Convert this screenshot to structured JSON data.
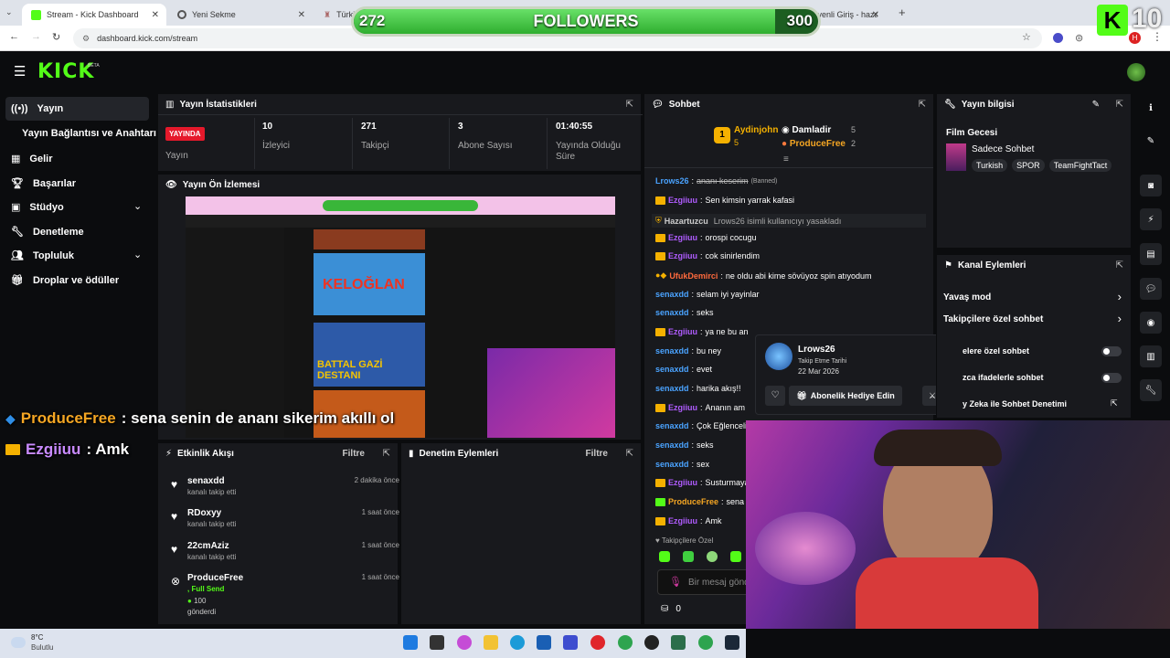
{
  "browser": {
    "tabs": [
      {
        "title": "Stream - Kick Dashboard",
        "active": true
      },
      {
        "title": "Yeni Sekme",
        "active": false
      },
      {
        "title": "Türki",
        "active": false
      },
      {
        "title": "e-posta Güvenli Giriş - hazartu",
        "active": false
      }
    ],
    "url": "dashboard.kick.com/stream"
  },
  "followers_goal": {
    "current": "272",
    "label": "FOLLOWERS",
    "target": "300",
    "progress": 0.907
  },
  "corner_count": "10",
  "sidebar": {
    "items": [
      {
        "label": "Yayın",
        "icon": "broadcast-icon",
        "active": true
      },
      {
        "label": "Yayın Bağlantısı ve Anahtarı",
        "icon": "",
        "active": false
      },
      {
        "label": "Gelir",
        "icon": "revenue-icon",
        "active": false
      },
      {
        "label": "Başarılar",
        "icon": "trophy-icon",
        "active": false
      },
      {
        "label": "Stüdyo",
        "icon": "studio-icon",
        "active": false
      },
      {
        "label": "Denetleme",
        "icon": "wrench-icon",
        "active": false
      },
      {
        "label": "Topluluk",
        "icon": "community-icon",
        "active": false
      },
      {
        "label": "Droplar ve ödüller",
        "icon": "gift-icon",
        "active": false
      }
    ]
  },
  "stats": {
    "title": "Yayın İstatistikleri",
    "live_badge": "YAYINDA",
    "live_label": "Yayın",
    "items": [
      {
        "value": "10",
        "label": "İzleyici"
      },
      {
        "value": "271",
        "label": "Takipçi"
      },
      {
        "value": "3",
        "label": "Abone Sayısı"
      },
      {
        "value": "01:40:55",
        "label": "Yayında Olduğu Süre"
      }
    ]
  },
  "preview": {
    "title": "Yayın Ön İzlemesi"
  },
  "chat": {
    "title": "Sohbet",
    "leaders": [
      {
        "rank": "1",
        "name": "Aydinjohn",
        "count": "5"
      },
      {
        "name": "Damladir",
        "count": "5"
      },
      {
        "name": "ProduceFree",
        "count": "2"
      }
    ],
    "messages": [
      {
        "user": "Lrows26",
        "text": "ananı keserim",
        "tag": "(Banned)",
        "color": "#4aa3ff",
        "badge": "",
        "struck": true
      },
      {
        "user": "Ezgiiuu",
        "text": "Sen kimsin yarrak kafasi",
        "color": "#b05cff",
        "badge": "crown"
      },
      {
        "user": "Hazartuzcu",
        "text": "Lrows26 isimli kullanıcıyı yasakladı",
        "color": "#cccccc",
        "badge": "shield",
        "system": true
      },
      {
        "user": "Ezgiiuu",
        "text": "orospi cocugu",
        "color": "#b05cff",
        "badge": "crown"
      },
      {
        "user": "Ezgiiuu",
        "text": "cok sinirlendim",
        "color": "#b05cff",
        "badge": "crown"
      },
      {
        "user": "UfukDemirci",
        "text": "ne oldu abi kime sövüyoz spin atıyodum",
        "color": "#ff6a3d",
        "badge": "rank"
      },
      {
        "user": "senaxdd",
        "text": "selam iyi yayinlar",
        "color": "#4aa3ff",
        "badge": ""
      },
      {
        "user": "senaxdd",
        "text": "seks",
        "color": "#4aa3ff",
        "badge": ""
      },
      {
        "user": "Ezgiiuu",
        "text": "ya ne bu an",
        "color": "#b05cff",
        "badge": "crown"
      },
      {
        "user": "senaxdd",
        "text": "bu ney",
        "color": "#4aa3ff",
        "badge": ""
      },
      {
        "user": "senaxdd",
        "text": "evet",
        "color": "#4aa3ff",
        "badge": ""
      },
      {
        "user": "senaxdd",
        "text": "harika akış!!",
        "color": "#4aa3ff",
        "badge": ""
      },
      {
        "user": "Ezgiiuu",
        "text": "Ananın am",
        "color": "#b05cff",
        "badge": "crown"
      },
      {
        "user": "senaxdd",
        "text": "Çok Eğlenceli",
        "color": "#4aa3ff",
        "badge": ""
      },
      {
        "user": "senaxdd",
        "text": "seks",
        "color": "#4aa3ff",
        "badge": ""
      },
      {
        "user": "senaxdd",
        "text": "sex",
        "color": "#4aa3ff",
        "badge": ""
      },
      {
        "user": "Ezgiiuu",
        "text": "Susturmaya",
        "color": "#b05cff",
        "badge": "crown"
      },
      {
        "user": "ProduceFree",
        "text": "sena",
        "color": "#f5a623",
        "badge": "green"
      },
      {
        "user": "Ezgiiuu",
        "text": "Amk",
        "color": "#b05cff",
        "badge": "crown"
      }
    ],
    "followers_only": "Takipçilere Özel",
    "input_placeholder": "Bir mesaj gönd",
    "footer_count": "0"
  },
  "user_card": {
    "name": "Lrows26",
    "follow_label": "Takip Etme Tarihi",
    "follow_date": "22 Mar 2026",
    "gift_button": "Abonelik Hediye Edin"
  },
  "stream_info": {
    "title": "Yayın bilgisi",
    "stream_title": "Film Gecesi",
    "category": "Sadece Sohbet",
    "tags": [
      "Turkish",
      "SPOR",
      "TeamFightTact"
    ]
  },
  "channel_actions": {
    "title": "Kanal Eylemleri",
    "items": [
      {
        "label": "Yavaş mod",
        "type": "chevron"
      },
      {
        "label": "Takipçilere özel sohbet",
        "type": "chevron"
      },
      {
        "label": "elere özel sohbet",
        "type": "toggle"
      },
      {
        "label": "zca ifadelerle sohbet",
        "type": "toggle"
      },
      {
        "label": "y Zeka ile Sohbet Denetimi",
        "type": "link"
      }
    ]
  },
  "activity": {
    "title": "Etkinlik Akışı",
    "filter": "Filtre",
    "events": [
      {
        "name": "senaxdd",
        "sub": "kanalı takip etti",
        "time": "2 dakika önce"
      },
      {
        "name": "RDoxyy",
        "sub": "kanalı takip etti",
        "time": "1 saat önce"
      },
      {
        "name": "22cmAziz",
        "sub": "kanalı takip etti",
        "time": "1 saat önce"
      },
      {
        "name": "ProduceFree",
        "sub": ", Full Send",
        "extra": "100",
        "extra2": "gönderdi",
        "time": "1 saat önce"
      }
    ]
  },
  "moderation": {
    "title": "Denetim Eylemleri",
    "filter": "Filtre"
  },
  "overlay_chat": [
    {
      "user": "ProduceFree",
      "text": ": sena senin de ananı sikerim akıllı ol",
      "color": "#f5a623"
    },
    {
      "user": "Ezgiiuu",
      "text": ": Amk",
      "color": "#c98bff"
    }
  ],
  "taskbar": {
    "temp": "8°C",
    "weather": "Bulutlu"
  }
}
